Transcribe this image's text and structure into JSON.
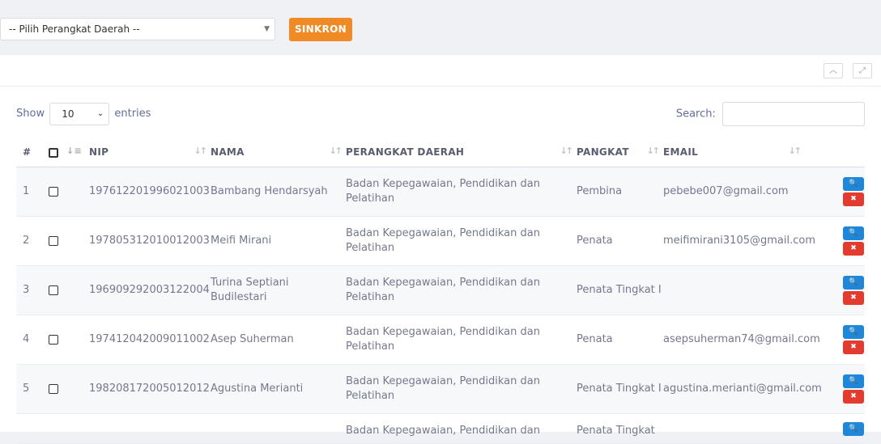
{
  "filter": {
    "select_value": "-- Pilih Perangkat Daerah --",
    "sync_label": "SINKRON"
  },
  "panel": {
    "collapse_icon": "chevron-up-icon",
    "expand_icon": "expand-icon"
  },
  "table_controls": {
    "show_label": "Show",
    "entries_value": "10",
    "entries_label": "entries",
    "search_label": "Search:"
  },
  "table": {
    "headers": {
      "index": "#",
      "nip": "NIP",
      "nama": "NAMA",
      "perangkat": "PERANGKAT DAERAH",
      "pangkat": "PANGKAT",
      "email": "EMAIL"
    },
    "rows": [
      {
        "no": "1",
        "nip": "197612201996021003",
        "nama": "Bambang Hendarsyah",
        "perangkat": "Badan Kepegawaian, Pendidikan dan Pelatihan",
        "pangkat": "Pembina",
        "email": "pebebe007@gmail.com"
      },
      {
        "no": "2",
        "nip": "197805312010012003",
        "nama": "Meifi Mirani",
        "perangkat": "Badan Kepegawaian, Pendidikan dan Pelatihan",
        "pangkat": "Penata",
        "email": "meifimirani3105@gmail.com"
      },
      {
        "no": "3",
        "nip": "196909292003122004",
        "nama": "Turina Septiani Budilestari",
        "perangkat": "Badan Kepegawaian, Pendidikan dan Pelatihan",
        "pangkat": "Penata Tingkat I",
        "email": ""
      },
      {
        "no": "4",
        "nip": "197412042009011002",
        "nama": "Asep Suherman",
        "perangkat": "Badan Kepegawaian, Pendidikan dan Pelatihan",
        "pangkat": "Penata",
        "email": "asepsuherman74@gmail.com"
      },
      {
        "no": "5",
        "nip": "198208172005012012",
        "nama": "Agustina Merianti",
        "perangkat": "Badan Kepegawaian, Pendidikan dan Pelatihan",
        "pangkat": "Penata Tingkat I",
        "email": "agustina.merianti@gmail.com"
      },
      {
        "no": "",
        "nip": "",
        "nama": "",
        "perangkat": "Badan Kepegawaian, Pendidikan dan",
        "pangkat": "Penata Tingkat",
        "email": ""
      }
    ]
  },
  "colors": {
    "accent_orange": "#f08a24",
    "view_blue": "#1f87d9",
    "delete_red": "#e33b2e"
  }
}
